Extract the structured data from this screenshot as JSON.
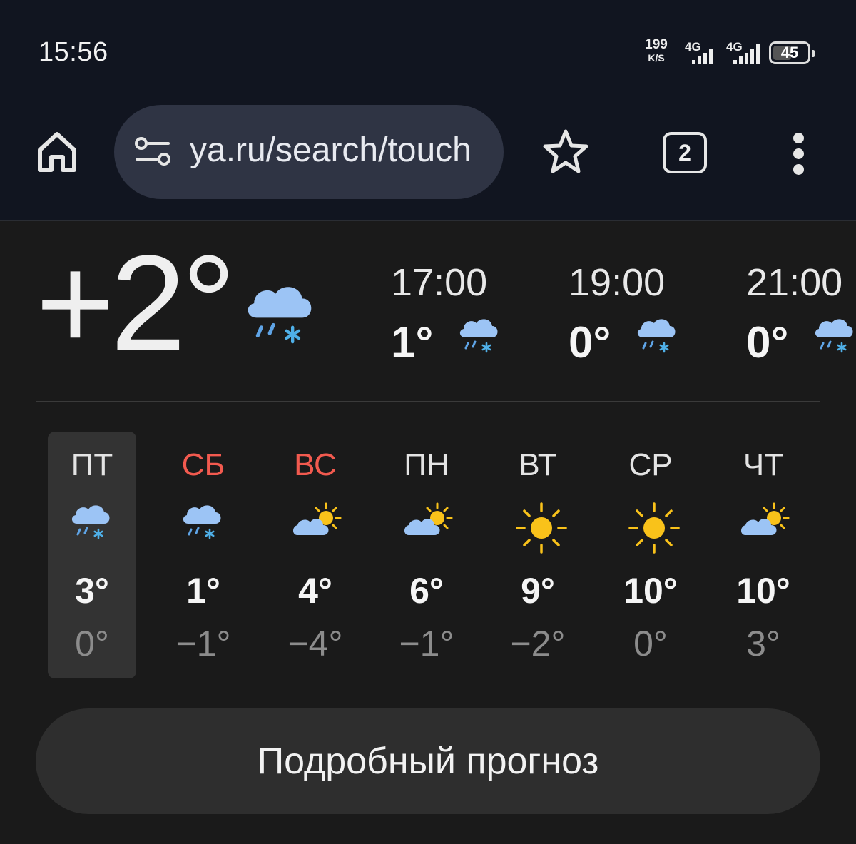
{
  "status_bar": {
    "time": "15:56",
    "net_speed_value": "199",
    "net_speed_unit": "K/S",
    "signal1_label": "4G",
    "signal2_label": "4G",
    "battery": "45"
  },
  "browser": {
    "url": "ya.ru/search/touch",
    "tab_count": "2"
  },
  "weather": {
    "current_temp": "+2°",
    "current_icon": "rain-snow-cloud-icon",
    "hourly": [
      {
        "time": "17:00",
        "temp": "1°",
        "icon": "rain-snow-cloud-icon"
      },
      {
        "time": "19:00",
        "temp": "0°",
        "icon": "rain-snow-cloud-icon"
      },
      {
        "time": "21:00",
        "temp": "0°",
        "icon": "rain-snow-cloud-icon"
      }
    ],
    "days": [
      {
        "name": "ПТ",
        "max": "3°",
        "min": "0°",
        "icon": "rain-snow-cloud-icon",
        "weekend": false,
        "selected": true
      },
      {
        "name": "СБ",
        "max": "1°",
        "min": "−1°",
        "icon": "rain-snow-cloud-icon",
        "weekend": true,
        "selected": false
      },
      {
        "name": "ВС",
        "max": "4°",
        "min": "−4°",
        "icon": "partly-cloudy-icon",
        "weekend": true,
        "selected": false
      },
      {
        "name": "ПН",
        "max": "6°",
        "min": "−1°",
        "icon": "partly-cloudy-icon",
        "weekend": false,
        "selected": false
      },
      {
        "name": "ВТ",
        "max": "9°",
        "min": "−2°",
        "icon": "sun-icon",
        "weekend": false,
        "selected": false
      },
      {
        "name": "СР",
        "max": "10°",
        "min": "0°",
        "icon": "sun-icon",
        "weekend": false,
        "selected": false
      },
      {
        "name": "ЧТ",
        "max": "10°",
        "min": "3°",
        "icon": "partly-cloudy-icon",
        "weekend": false,
        "selected": false
      }
    ],
    "details_button": "Подробный прогноз"
  },
  "colors": {
    "weekend_red": "#f25a4f",
    "cloud_blue": "#9cc4f5",
    "sun_yellow": "#f9c21a"
  }
}
